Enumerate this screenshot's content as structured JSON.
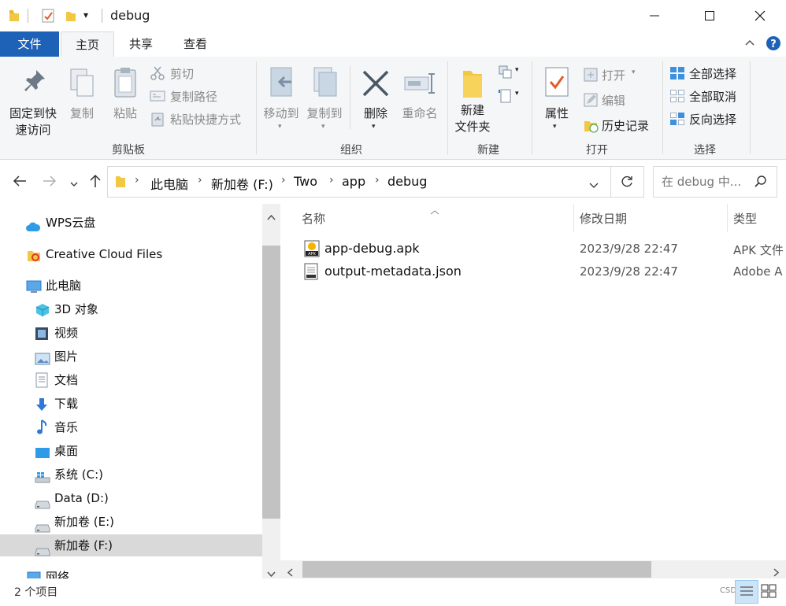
{
  "window": {
    "title": "debug"
  },
  "ribbon_tabs": [
    {
      "label": "文件"
    },
    {
      "label": "主页"
    },
    {
      "label": "共享"
    },
    {
      "label": "查看"
    }
  ],
  "ribbon": {
    "clipboard": {
      "pin_label_1": "固定到快",
      "pin_label_2": "速访问",
      "copy_label": "复制",
      "paste_label": "粘贴",
      "cut_label": "剪切",
      "copy_path_label": "复制路径",
      "paste_shortcut_label": "粘贴快捷方式",
      "group_label": "剪贴板"
    },
    "organize": {
      "move_to_label": "移动到",
      "copy_to_label": "复制到",
      "delete_label": "删除",
      "rename_label": "重命名",
      "group_label": "组织"
    },
    "new": {
      "new_folder_label_1": "新建",
      "new_folder_label_2": "文件夹",
      "group_label": "新建"
    },
    "open": {
      "properties_label": "属性",
      "open_label": "打开",
      "edit_label": "编辑",
      "history_label": "历史记录",
      "group_label": "打开"
    },
    "select": {
      "select_all_label": "全部选择",
      "select_none_label": "全部取消",
      "invert_label": "反向选择",
      "group_label": "选择"
    }
  },
  "address": {
    "crumbs": [
      "此电脑",
      "新加卷 (F:)",
      "Two",
      "app",
      "debug"
    ],
    "search_placeholder": "在 debug 中..."
  },
  "nav": {
    "items": [
      {
        "label": "WPS云盘"
      },
      {
        "label": "Creative Cloud Files"
      },
      {
        "label": "此电脑"
      },
      {
        "label": "3D 对象"
      },
      {
        "label": "视频"
      },
      {
        "label": "图片"
      },
      {
        "label": "文档"
      },
      {
        "label": "下载"
      },
      {
        "label": "音乐"
      },
      {
        "label": "桌面"
      },
      {
        "label": "系统 (C:)"
      },
      {
        "label": "Data (D:)"
      },
      {
        "label": "新加卷 (E:)"
      },
      {
        "label": "新加卷 (F:)"
      },
      {
        "label": "网络"
      }
    ],
    "selected": "新加卷 (F:)"
  },
  "files": {
    "columns": {
      "name": "名称",
      "modified": "修改日期",
      "type": "类型"
    },
    "rows": [
      {
        "name": "app-debug.apk",
        "modified": "2023/9/28 22:47",
        "type": "APK 文件"
      },
      {
        "name": "output-metadata.json",
        "modified": "2023/9/28 22:47",
        "type": "Adobe A"
      }
    ]
  },
  "status": {
    "item_count": "2 个项目",
    "watermark": "CSDN @"
  },
  "colors": {
    "file_tab": "#1e62b8",
    "ribbon_bg": "#f5f6f7",
    "selected_nav": "#d9d9d9",
    "folder": "#f2c744",
    "accent_blue": "#2f78d4"
  }
}
